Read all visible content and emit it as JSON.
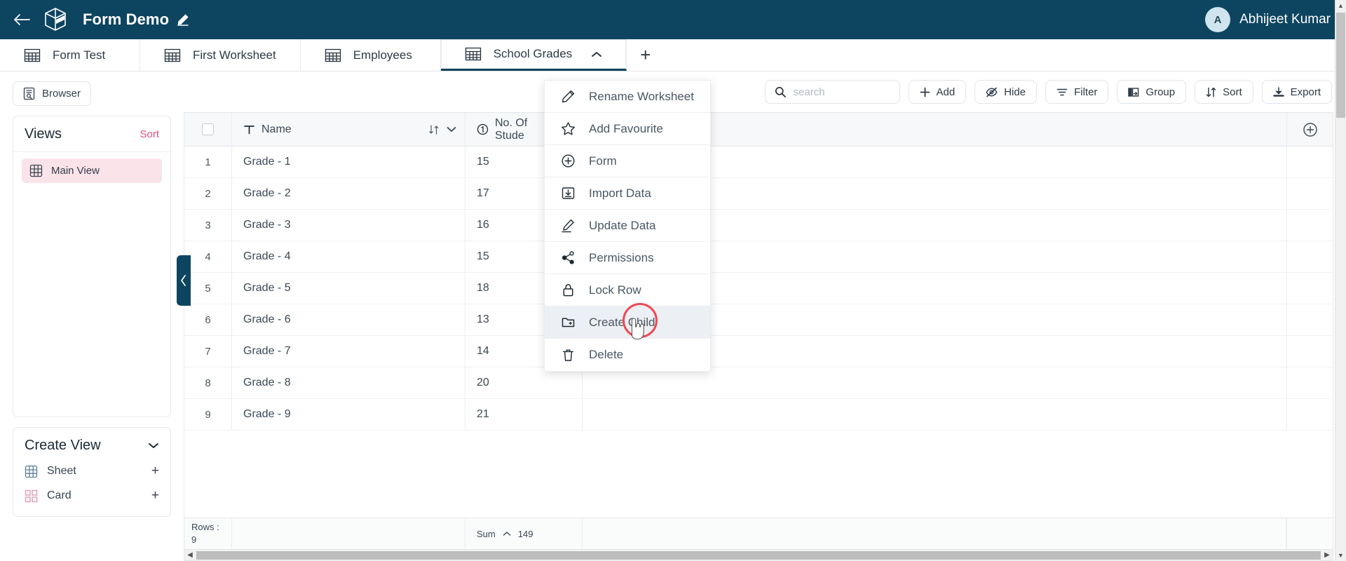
{
  "header": {
    "back_icon": "arrow-left-icon",
    "logo_icon": "cube-logo-icon",
    "title": "Form Demo",
    "edit_icon": "pencil-icon",
    "user": {
      "initial": "A",
      "name": "Abhijeet Kumar"
    }
  },
  "tabs": {
    "items": [
      {
        "label": "Form Test",
        "icon": "table-icon",
        "active": false
      },
      {
        "label": "First Worksheet",
        "icon": "table-icon",
        "active": false
      },
      {
        "label": "Employees",
        "icon": "table-icon",
        "active": false
      },
      {
        "label": "School Grades",
        "icon": "table-icon",
        "active": true
      }
    ],
    "add_label": "+"
  },
  "sidebar": {
    "browser_label": "Browser",
    "browser_icon": "browser-icon",
    "views": {
      "title": "Views",
      "sort_label": "Sort",
      "items": [
        {
          "label": "Main View",
          "icon": "grid-icon",
          "selected": true
        }
      ]
    },
    "create_view": {
      "title": "Create View",
      "chevron_icon": "chevron-down-icon",
      "items": [
        {
          "label": "Sheet",
          "icon": "grid-icon",
          "action": "+"
        },
        {
          "label": "Card",
          "icon": "cards-icon",
          "action": "+"
        }
      ]
    },
    "collapse_icon": "chevron-left-icon"
  },
  "toolbar": {
    "search_placeholder": "search",
    "search_value": "",
    "search_icon": "search-icon",
    "buttons": [
      {
        "label": "Add",
        "icon": "plus-icon"
      },
      {
        "label": "Hide",
        "icon": "eye-off-icon"
      },
      {
        "label": "Filter",
        "icon": "filter-icon"
      },
      {
        "label": "Group",
        "icon": "group-icon"
      },
      {
        "label": "Sort",
        "icon": "sort-icon"
      },
      {
        "label": "Export",
        "icon": "download-icon"
      }
    ]
  },
  "menu": {
    "items": [
      {
        "label": "Rename Worksheet",
        "icon": "pencil-icon",
        "highlight": false
      },
      {
        "label": "Add Favourite",
        "icon": "star-icon",
        "highlight": false
      },
      {
        "label": "Form",
        "icon": "plus-circle-icon",
        "highlight": false
      },
      {
        "label": "Import Data",
        "icon": "import-icon",
        "highlight": false
      },
      {
        "label": "Update Data",
        "icon": "pencil-underline-icon",
        "highlight": false
      },
      {
        "label": "Permissions",
        "icon": "share-icon",
        "highlight": false
      },
      {
        "label": "Lock Row",
        "icon": "lock-icon",
        "highlight": false
      },
      {
        "label": "Create Child",
        "icon": "folder-plus-icon",
        "highlight": true
      },
      {
        "label": "Delete",
        "icon": "trash-icon",
        "highlight": false
      }
    ]
  },
  "table": {
    "columns": [
      {
        "label": "Name",
        "type_icon": "text-type-icon",
        "sort_icon": "sort-arrows-icon",
        "menu_icon": "chevron-down-icon"
      },
      {
        "label": "No. Of Stude",
        "type_icon": "number-type-icon",
        "sort_icon": "sort-arrows-icon",
        "menu_icon": "chevron-down-icon"
      }
    ],
    "add_column_icon": "plus-circle-icon",
    "rows": [
      {
        "index": "1",
        "name": "Grade - 1",
        "students": "15"
      },
      {
        "index": "2",
        "name": "Grade - 2",
        "students": "17"
      },
      {
        "index": "3",
        "name": "Grade - 3",
        "students": "16"
      },
      {
        "index": "4",
        "name": "Grade - 4",
        "students": "15"
      },
      {
        "index": "5",
        "name": "Grade - 5",
        "students": "18"
      },
      {
        "index": "6",
        "name": "Grade - 6",
        "students": "13"
      },
      {
        "index": "7",
        "name": "Grade - 7",
        "students": "14"
      },
      {
        "index": "8",
        "name": "Grade - 8",
        "students": "20"
      },
      {
        "index": "9",
        "name": "Grade - 9",
        "students": "21"
      }
    ],
    "footer": {
      "rows_label": "Rows :",
      "rows_count": "9",
      "sum_label": "Sum",
      "sum_caret": "chevron-up-icon",
      "sum_value": "149"
    }
  },
  "colors": {
    "topbar": "#0d4560",
    "accent_pink": "#e0517c",
    "selected_view_bg": "#fbe3ea",
    "annotation_red": "#ee4b55"
  }
}
